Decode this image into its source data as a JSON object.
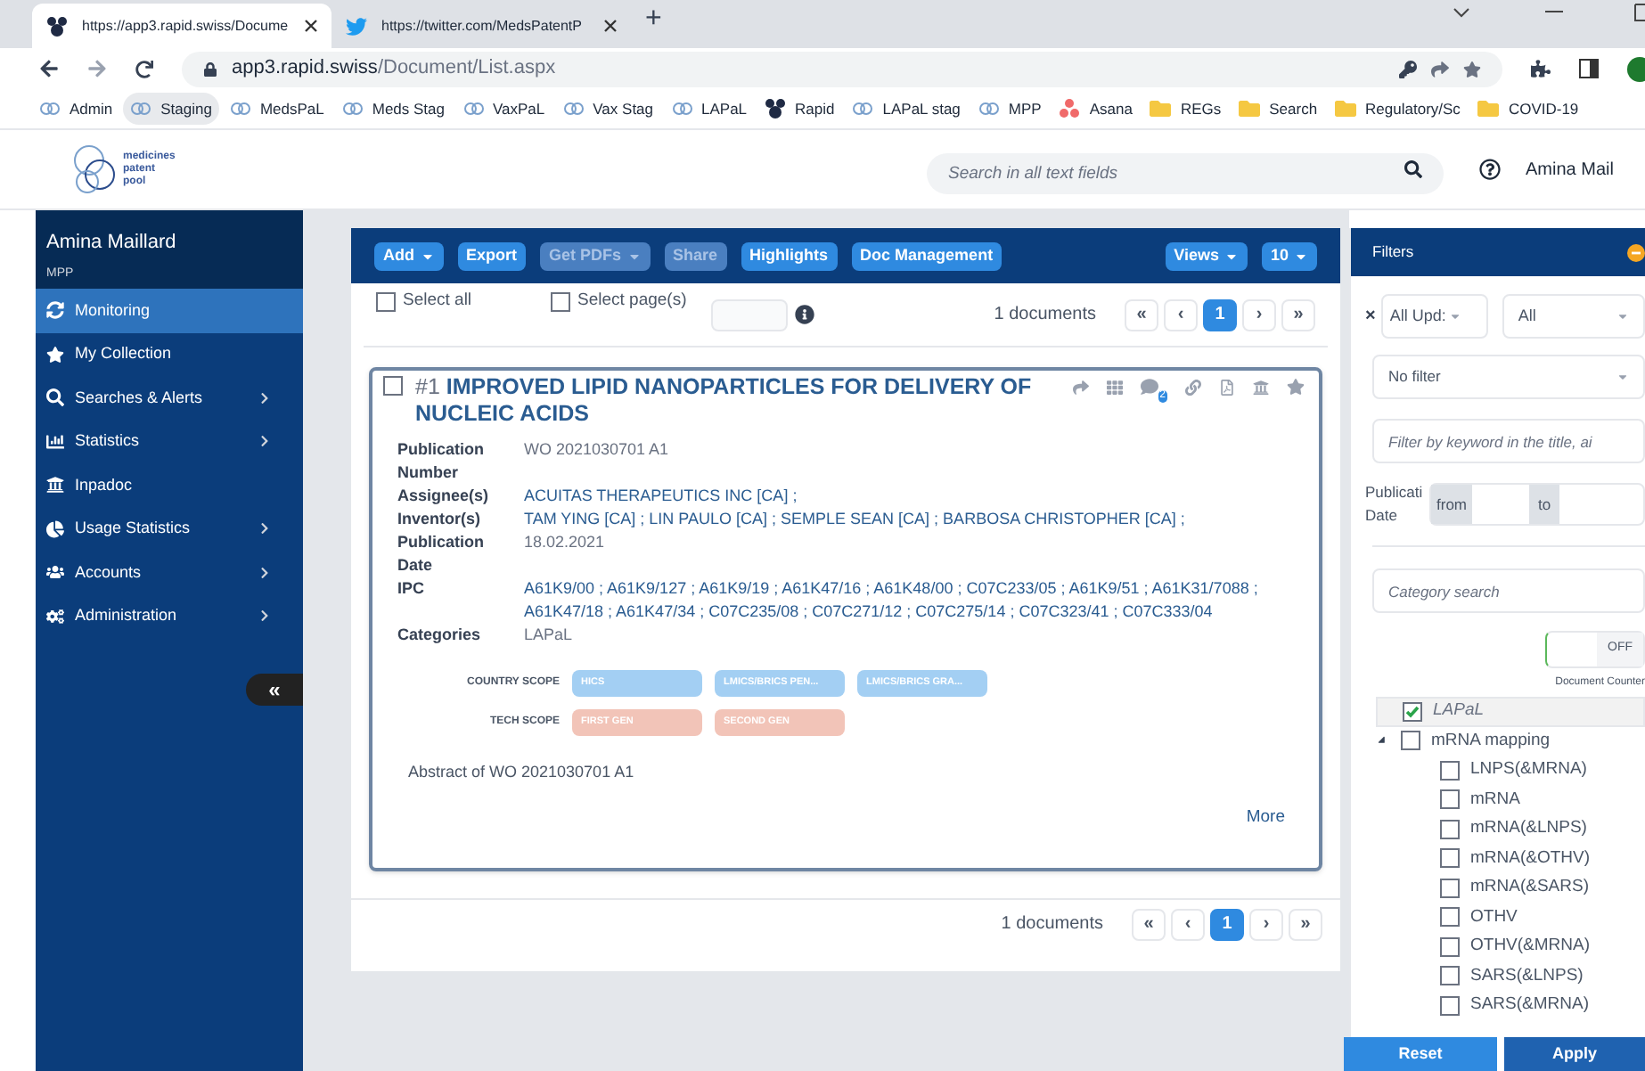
{
  "browser": {
    "tabs": [
      {
        "title": "https://app3.rapid.swiss/Docume",
        "selected": true
      },
      {
        "title": "https://twitter.com/MedsPatentP",
        "selected": false
      }
    ],
    "new_tab": "+",
    "url_host": "app3.rapid.swiss",
    "url_path": "/Document/List.aspx",
    "bookmarks": [
      {
        "label": "Admin",
        "kind": "site",
        "selected": false
      },
      {
        "label": "Staging",
        "kind": "site",
        "selected": true
      },
      {
        "label": "MedsPaL",
        "kind": "site",
        "selected": false
      },
      {
        "label": "Meds Stag",
        "kind": "site",
        "selected": false
      },
      {
        "label": "VaxPaL",
        "kind": "site",
        "selected": false
      },
      {
        "label": "Vax Stag",
        "kind": "site",
        "selected": false
      },
      {
        "label": "LAPaL",
        "kind": "site",
        "selected": false
      },
      {
        "label": "Rapid",
        "kind": "rapid",
        "selected": false
      },
      {
        "label": "LAPaL stag",
        "kind": "site",
        "selected": false
      },
      {
        "label": "MPP",
        "kind": "site",
        "selected": false
      },
      {
        "label": "Asana",
        "kind": "asana",
        "selected": false
      },
      {
        "label": "REGs",
        "kind": "folder",
        "selected": false
      },
      {
        "label": "Search",
        "kind": "folder",
        "selected": false
      },
      {
        "label": "Regulatory/Sc",
        "kind": "folder",
        "selected": false
      },
      {
        "label": "COVID-19",
        "kind": "folder",
        "selected": false
      }
    ]
  },
  "header": {
    "logo": [
      "medicines",
      "patent",
      "pool"
    ],
    "search": {
      "placeholder": "Search in all text fields"
    },
    "user": "Amina Mail"
  },
  "sidebar": {
    "user": "Amina Maillard",
    "org": "MPP",
    "collapse": "«",
    "items": [
      {
        "label": "Monitoring",
        "selected": true,
        "has_submenu": false
      },
      {
        "label": "My Collection",
        "selected": false,
        "has_submenu": false
      },
      {
        "label": "Searches & Alerts",
        "selected": false,
        "has_submenu": true
      },
      {
        "label": "Statistics",
        "selected": false,
        "has_submenu": true
      },
      {
        "label": "Inpadoc",
        "selected": false,
        "has_submenu": false
      },
      {
        "label": "Usage Statistics",
        "selected": false,
        "has_submenu": true
      },
      {
        "label": "Accounts",
        "selected": false,
        "has_submenu": true
      },
      {
        "label": "Administration",
        "selected": false,
        "has_submenu": true
      }
    ]
  },
  "toolbar": {
    "left": [
      {
        "label": "Add",
        "dropdown": true,
        "disabled": false
      },
      {
        "label": "Export",
        "dropdown": false,
        "disabled": false
      },
      {
        "label": "Get PDFs",
        "dropdown": true,
        "disabled": true
      },
      {
        "label": "Share",
        "dropdown": false,
        "disabled": true
      },
      {
        "label": "Highlights",
        "dropdown": false,
        "disabled": false
      },
      {
        "label": "Doc Management",
        "dropdown": false,
        "disabled": false
      }
    ],
    "right": [
      {
        "label": "Views",
        "dropdown": true,
        "disabled": false
      },
      {
        "label": "10",
        "dropdown": true,
        "disabled": false
      }
    ]
  },
  "selection": {
    "select_all": {
      "label": "Select all",
      "checked": false
    },
    "select_pages": {
      "label": "Select page(s)",
      "checked": false
    }
  },
  "pagination_top": {
    "count": "1 documents",
    "pages": [
      {
        "label": "«",
        "selected": false
      },
      {
        "label": "‹",
        "selected": false
      },
      {
        "label": "1",
        "selected": true
      },
      {
        "label": "›",
        "selected": false
      },
      {
        "label": "»",
        "selected": false
      }
    ]
  },
  "document": {
    "checked": false,
    "number": "#1",
    "title": "IMPROVED LIPID NANOPARTICLES FOR DELIVERY OF NUCLEIC ACIDS",
    "comments": "2",
    "fields": [
      {
        "label": "Publication Number",
        "value": "WO 2021030701 A1",
        "kind": "plain"
      },
      {
        "label": "Assignee(s)",
        "value": "ACUITAS THERAPEUTICS INC [CA] ;",
        "kind": "link"
      },
      {
        "label": "Inventor(s)",
        "value": "TAM YING [CA] ; LIN PAULO [CA] ; SEMPLE SEAN [CA] ; BARBOSA CHRISTOPHER [CA] ;",
        "kind": "link"
      },
      {
        "label": "Publication Date",
        "value": "18.02.2021",
        "kind": "plain"
      },
      {
        "label": "IPC",
        "value": "A61K9/00 ; A61K9/127 ; A61K9/19 ; A61K47/16 ; A61K48/00 ; C07C233/05 ; A61K9/51 ; A61K31/7088 ; A61K47/18 ; A61K47/34 ; C07C235/08 ; C07C271/12 ; C07C275/14 ; C07C323/41 ; C07C333/04",
        "kind": "link"
      },
      {
        "label": "Categories",
        "value": "LAPaL",
        "kind": "plain"
      }
    ],
    "scopes": [
      {
        "label": "COUNTRY SCOPE",
        "tags": [
          {
            "text": "HICS",
            "color": "#a3cff3"
          },
          {
            "text": "LMICS/BRICS PEN...",
            "color": "#a3cff3"
          },
          {
            "text": "LMICS/BRICS GRA...",
            "color": "#a3cff3"
          }
        ]
      },
      {
        "label": "TECH SCOPE",
        "tags": [
          {
            "text": "FIRST GEN",
            "color": "#f2c4b8"
          },
          {
            "text": "SECOND GEN",
            "color": "#f2c4b8"
          }
        ]
      }
    ],
    "abstract": "Abstract of WO 2021030701 A1",
    "more": "More"
  },
  "pagination_bottom": {
    "count": "1 documents",
    "pages": [
      {
        "label": "«",
        "selected": false
      },
      {
        "label": "‹",
        "selected": false
      },
      {
        "label": "1",
        "selected": true
      },
      {
        "label": "›",
        "selected": false
      },
      {
        "label": "»",
        "selected": false
      }
    ]
  },
  "filters": {
    "title": "Filters",
    "clear": "×",
    "update_select": "All Upd:",
    "scope_select": "All",
    "filter_select": "No filter",
    "keyword": {
      "placeholder": "Filter by keyword in the title, ai"
    },
    "date": {
      "label": [
        "Publicati",
        "Date"
      ],
      "from": "from",
      "to": "to"
    },
    "category": {
      "placeholder": "Category search"
    },
    "counter_toggle": {
      "text": "OFF",
      "on": false
    },
    "counter_label": "Document Counter",
    "tree": [
      {
        "label": "LAPaL",
        "checked": true,
        "selected": true
      },
      {
        "label": "mRNA mapping",
        "checked": false,
        "selected": false,
        "expanded": true,
        "children": [
          {
            "label": "LNPS(&MRNA)",
            "checked": false,
            "selected": false
          },
          {
            "label": "mRNA",
            "checked": false,
            "selected": false
          },
          {
            "label": "mRNA(&LNPS)",
            "checked": false,
            "selected": false
          },
          {
            "label": "mRNA(&OTHV)",
            "checked": false,
            "selected": false
          },
          {
            "label": "mRNA(&SARS)",
            "checked": false,
            "selected": false
          },
          {
            "label": "OTHV",
            "checked": false,
            "selected": false
          },
          {
            "label": "OTHV(&MRNA)",
            "checked": false,
            "selected": false
          },
          {
            "label": "SARS(&LNPS)",
            "checked": false,
            "selected": false
          },
          {
            "label": "SARS(&MRNA)",
            "checked": false,
            "selected": false
          }
        ]
      }
    ],
    "reset": "Reset",
    "apply": "Apply"
  }
}
